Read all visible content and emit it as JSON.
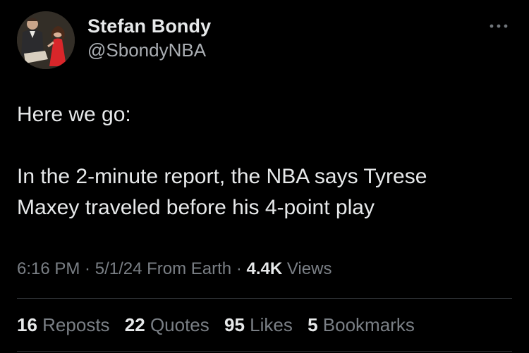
{
  "author": {
    "display_name": "Stefan Bondy",
    "handle": "@SbondyNBA"
  },
  "tweet": {
    "line1": "Here we go:",
    "line2": "In the 2-minute report, the NBA says Tyrese",
    "line3": "Maxey traveled before his 4-point play"
  },
  "meta": {
    "time": "6:16 PM",
    "sep1": " · ",
    "date": "5/1/24",
    "source": " From Earth",
    "sep2": " · ",
    "views_count": "4.4K",
    "views_label": " Views"
  },
  "stats": [
    {
      "count": "16",
      "label": "Reposts"
    },
    {
      "count": "22",
      "label": "Quotes"
    },
    {
      "count": "95",
      "label": "Likes"
    },
    {
      "count": "5",
      "label": "Bookmarks"
    }
  ],
  "icons": {
    "more": "more-horizontal-icon"
  },
  "colors": {
    "background": "#000000",
    "primary_text": "#e7e9ea",
    "secondary_text": "#7a7f85",
    "divider": "#2f3336"
  }
}
